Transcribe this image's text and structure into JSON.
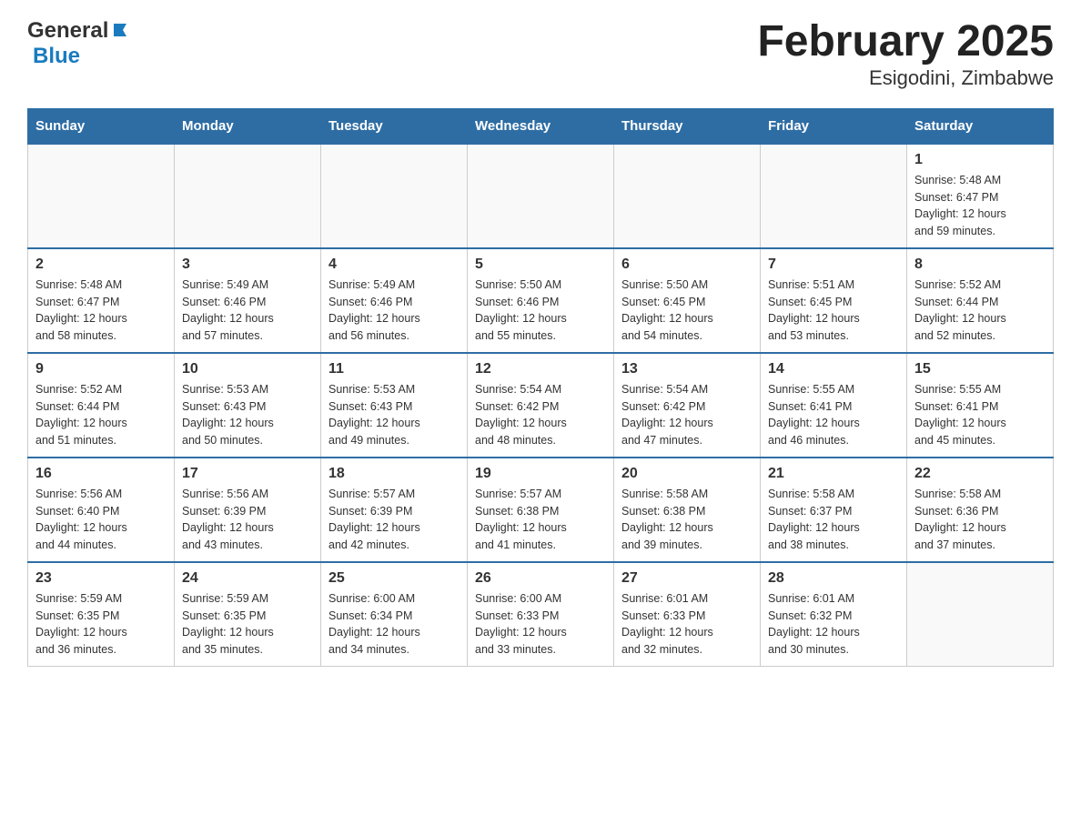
{
  "header": {
    "logo_general": "General",
    "logo_blue": "Blue",
    "title": "February 2025",
    "subtitle": "Esigodini, Zimbabwe"
  },
  "days_of_week": [
    "Sunday",
    "Monday",
    "Tuesday",
    "Wednesday",
    "Thursday",
    "Friday",
    "Saturday"
  ],
  "weeks": [
    {
      "days": [
        {
          "number": "",
          "info": ""
        },
        {
          "number": "",
          "info": ""
        },
        {
          "number": "",
          "info": ""
        },
        {
          "number": "",
          "info": ""
        },
        {
          "number": "",
          "info": ""
        },
        {
          "number": "",
          "info": ""
        },
        {
          "number": "1",
          "info": "Sunrise: 5:48 AM\nSunset: 6:47 PM\nDaylight: 12 hours\nand 59 minutes."
        }
      ]
    },
    {
      "days": [
        {
          "number": "2",
          "info": "Sunrise: 5:48 AM\nSunset: 6:47 PM\nDaylight: 12 hours\nand 58 minutes."
        },
        {
          "number": "3",
          "info": "Sunrise: 5:49 AM\nSunset: 6:46 PM\nDaylight: 12 hours\nand 57 minutes."
        },
        {
          "number": "4",
          "info": "Sunrise: 5:49 AM\nSunset: 6:46 PM\nDaylight: 12 hours\nand 56 minutes."
        },
        {
          "number": "5",
          "info": "Sunrise: 5:50 AM\nSunset: 6:46 PM\nDaylight: 12 hours\nand 55 minutes."
        },
        {
          "number": "6",
          "info": "Sunrise: 5:50 AM\nSunset: 6:45 PM\nDaylight: 12 hours\nand 54 minutes."
        },
        {
          "number": "7",
          "info": "Sunrise: 5:51 AM\nSunset: 6:45 PM\nDaylight: 12 hours\nand 53 minutes."
        },
        {
          "number": "8",
          "info": "Sunrise: 5:52 AM\nSunset: 6:44 PM\nDaylight: 12 hours\nand 52 minutes."
        }
      ]
    },
    {
      "days": [
        {
          "number": "9",
          "info": "Sunrise: 5:52 AM\nSunset: 6:44 PM\nDaylight: 12 hours\nand 51 minutes."
        },
        {
          "number": "10",
          "info": "Sunrise: 5:53 AM\nSunset: 6:43 PM\nDaylight: 12 hours\nand 50 minutes."
        },
        {
          "number": "11",
          "info": "Sunrise: 5:53 AM\nSunset: 6:43 PM\nDaylight: 12 hours\nand 49 minutes."
        },
        {
          "number": "12",
          "info": "Sunrise: 5:54 AM\nSunset: 6:42 PM\nDaylight: 12 hours\nand 48 minutes."
        },
        {
          "number": "13",
          "info": "Sunrise: 5:54 AM\nSunset: 6:42 PM\nDaylight: 12 hours\nand 47 minutes."
        },
        {
          "number": "14",
          "info": "Sunrise: 5:55 AM\nSunset: 6:41 PM\nDaylight: 12 hours\nand 46 minutes."
        },
        {
          "number": "15",
          "info": "Sunrise: 5:55 AM\nSunset: 6:41 PM\nDaylight: 12 hours\nand 45 minutes."
        }
      ]
    },
    {
      "days": [
        {
          "number": "16",
          "info": "Sunrise: 5:56 AM\nSunset: 6:40 PM\nDaylight: 12 hours\nand 44 minutes."
        },
        {
          "number": "17",
          "info": "Sunrise: 5:56 AM\nSunset: 6:39 PM\nDaylight: 12 hours\nand 43 minutes."
        },
        {
          "number": "18",
          "info": "Sunrise: 5:57 AM\nSunset: 6:39 PM\nDaylight: 12 hours\nand 42 minutes."
        },
        {
          "number": "19",
          "info": "Sunrise: 5:57 AM\nSunset: 6:38 PM\nDaylight: 12 hours\nand 41 minutes."
        },
        {
          "number": "20",
          "info": "Sunrise: 5:58 AM\nSunset: 6:38 PM\nDaylight: 12 hours\nand 39 minutes."
        },
        {
          "number": "21",
          "info": "Sunrise: 5:58 AM\nSunset: 6:37 PM\nDaylight: 12 hours\nand 38 minutes."
        },
        {
          "number": "22",
          "info": "Sunrise: 5:58 AM\nSunset: 6:36 PM\nDaylight: 12 hours\nand 37 minutes."
        }
      ]
    },
    {
      "days": [
        {
          "number": "23",
          "info": "Sunrise: 5:59 AM\nSunset: 6:35 PM\nDaylight: 12 hours\nand 36 minutes."
        },
        {
          "number": "24",
          "info": "Sunrise: 5:59 AM\nSunset: 6:35 PM\nDaylight: 12 hours\nand 35 minutes."
        },
        {
          "number": "25",
          "info": "Sunrise: 6:00 AM\nSunset: 6:34 PM\nDaylight: 12 hours\nand 34 minutes."
        },
        {
          "number": "26",
          "info": "Sunrise: 6:00 AM\nSunset: 6:33 PM\nDaylight: 12 hours\nand 33 minutes."
        },
        {
          "number": "27",
          "info": "Sunrise: 6:01 AM\nSunset: 6:33 PM\nDaylight: 12 hours\nand 32 minutes."
        },
        {
          "number": "28",
          "info": "Sunrise: 6:01 AM\nSunset: 6:32 PM\nDaylight: 12 hours\nand 30 minutes."
        },
        {
          "number": "",
          "info": ""
        }
      ]
    }
  ]
}
